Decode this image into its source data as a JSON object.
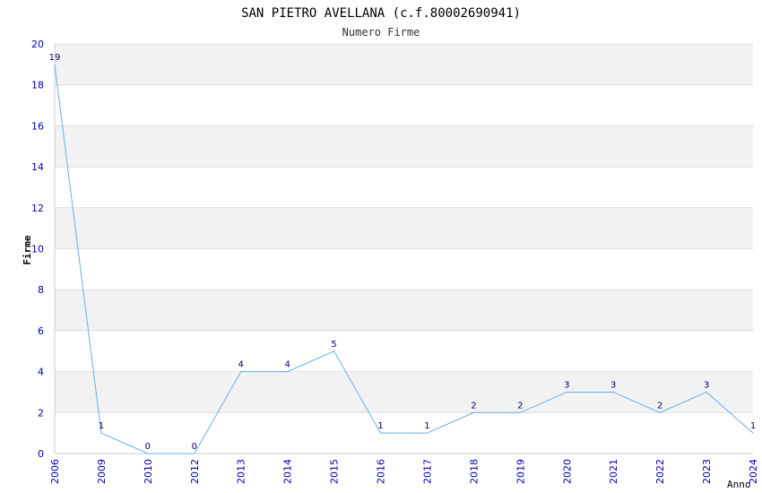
{
  "chart_data": {
    "type": "line",
    "title": "SAN PIETRO AVELLANA (c.f.80002690941)",
    "subtitle": "Numero Firme",
    "xlabel": "Anno",
    "ylabel": "Firme",
    "categories": [
      "2006",
      "2009",
      "2010",
      "2012",
      "2013",
      "2014",
      "2015",
      "2016",
      "2017",
      "2018",
      "2019",
      "2020",
      "2021",
      "2022",
      "2023",
      "2024"
    ],
    "values": [
      19,
      1,
      0,
      0,
      4,
      4,
      5,
      1,
      1,
      2,
      2,
      3,
      3,
      2,
      3,
      1
    ],
    "ylim": [
      0,
      20
    ],
    "yticks": [
      0,
      2,
      4,
      6,
      8,
      10,
      12,
      14,
      16,
      18,
      20
    ],
    "grid": true,
    "colors": {
      "line": "#6aaee8",
      "band": "#f2f2f2",
      "grid": "#dddddd",
      "tick": "#0000aa",
      "label": "#000066"
    }
  }
}
